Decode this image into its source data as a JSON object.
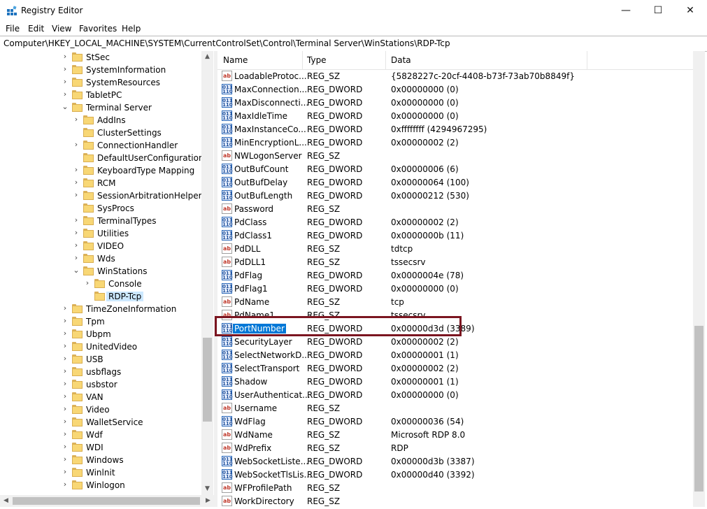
{
  "window": {
    "title": "Registry Editor",
    "minimize": "—",
    "maximize": "☐",
    "close": "✕"
  },
  "menu": [
    "File",
    "Edit",
    "View",
    "Favorites",
    "Help"
  ],
  "address": "Computer\\HKEY_LOCAL_MACHINE\\SYSTEM\\CurrentControlSet\\Control\\Terminal Server\\WinStations\\RDP-Tcp",
  "tree": [
    {
      "label": "StSec",
      "level": 0,
      "expander": "collapsed"
    },
    {
      "label": "SystemInformation",
      "level": 0,
      "expander": "collapsed"
    },
    {
      "label": "SystemResources",
      "level": 0,
      "expander": "collapsed"
    },
    {
      "label": "TabletPC",
      "level": 0,
      "expander": "collapsed"
    },
    {
      "label": "Terminal Server",
      "level": 0,
      "expander": "expanded"
    },
    {
      "label": "AddIns",
      "level": 1,
      "expander": "collapsed"
    },
    {
      "label": "ClusterSettings",
      "level": 1,
      "expander": "none"
    },
    {
      "label": "ConnectionHandler",
      "level": 1,
      "expander": "collapsed"
    },
    {
      "label": "DefaultUserConfiguration",
      "level": 1,
      "expander": "none"
    },
    {
      "label": "KeyboardType Mapping",
      "level": 1,
      "expander": "collapsed"
    },
    {
      "label": "RCM",
      "level": 1,
      "expander": "collapsed"
    },
    {
      "label": "SessionArbitrationHelper",
      "level": 1,
      "expander": "collapsed"
    },
    {
      "label": "SysProcs",
      "level": 1,
      "expander": "none"
    },
    {
      "label": "TerminalTypes",
      "level": 1,
      "expander": "collapsed"
    },
    {
      "label": "Utilities",
      "level": 1,
      "expander": "collapsed"
    },
    {
      "label": "VIDEO",
      "level": 1,
      "expander": "collapsed"
    },
    {
      "label": "Wds",
      "level": 1,
      "expander": "collapsed"
    },
    {
      "label": "WinStations",
      "level": 1,
      "expander": "expanded"
    },
    {
      "label": "Console",
      "level": 2,
      "expander": "collapsed"
    },
    {
      "label": "RDP-Tcp",
      "level": 2,
      "expander": "none",
      "selected": true
    },
    {
      "label": "TimeZoneInformation",
      "level": 0,
      "expander": "collapsed"
    },
    {
      "label": "Tpm",
      "level": 0,
      "expander": "collapsed"
    },
    {
      "label": "Ubpm",
      "level": 0,
      "expander": "collapsed"
    },
    {
      "label": "UnitedVideo",
      "level": 0,
      "expander": "collapsed"
    },
    {
      "label": "USB",
      "level": 0,
      "expander": "collapsed"
    },
    {
      "label": "usbflags",
      "level": 0,
      "expander": "collapsed"
    },
    {
      "label": "usbstor",
      "level": 0,
      "expander": "collapsed"
    },
    {
      "label": "VAN",
      "level": 0,
      "expander": "collapsed"
    },
    {
      "label": "Video",
      "level": 0,
      "expander": "collapsed"
    },
    {
      "label": "WalletService",
      "level": 0,
      "expander": "collapsed"
    },
    {
      "label": "Wdf",
      "level": 0,
      "expander": "collapsed"
    },
    {
      "label": "WDI",
      "level": 0,
      "expander": "collapsed"
    },
    {
      "label": "Windows",
      "level": 0,
      "expander": "collapsed"
    },
    {
      "label": "Winlnit",
      "level": 0,
      "expander": "collapsed"
    },
    {
      "label": "Winlogon",
      "level": 0,
      "expander": "collapsed"
    }
  ],
  "columns": {
    "name": "Name",
    "type": "Type",
    "data": "Data"
  },
  "values": [
    {
      "name": "LoadableProtoc...",
      "type": "REG_SZ",
      "data": "{5828227c-20cf-4408-b73f-73ab70b8849f}",
      "icon": "string"
    },
    {
      "name": "MaxConnection...",
      "type": "REG_DWORD",
      "data": "0x00000000 (0)",
      "icon": "binary"
    },
    {
      "name": "MaxDisconnecti...",
      "type": "REG_DWORD",
      "data": "0x00000000 (0)",
      "icon": "binary"
    },
    {
      "name": "MaxIdleTime",
      "type": "REG_DWORD",
      "data": "0x00000000 (0)",
      "icon": "binary"
    },
    {
      "name": "MaxInstanceCo...",
      "type": "REG_DWORD",
      "data": "0xffffffff (4294967295)",
      "icon": "binary"
    },
    {
      "name": "MinEncryptionL...",
      "type": "REG_DWORD",
      "data": "0x00000002 (2)",
      "icon": "binary"
    },
    {
      "name": "NWLogonServer",
      "type": "REG_SZ",
      "data": "",
      "icon": "string"
    },
    {
      "name": "OutBufCount",
      "type": "REG_DWORD",
      "data": "0x00000006 (6)",
      "icon": "binary"
    },
    {
      "name": "OutBufDelay",
      "type": "REG_DWORD",
      "data": "0x00000064 (100)",
      "icon": "binary"
    },
    {
      "name": "OutBufLength",
      "type": "REG_DWORD",
      "data": "0x00000212 (530)",
      "icon": "binary"
    },
    {
      "name": "Password",
      "type": "REG_SZ",
      "data": "",
      "icon": "string"
    },
    {
      "name": "PdClass",
      "type": "REG_DWORD",
      "data": "0x00000002 (2)",
      "icon": "binary"
    },
    {
      "name": "PdClass1",
      "type": "REG_DWORD",
      "data": "0x0000000b (11)",
      "icon": "binary"
    },
    {
      "name": "PdDLL",
      "type": "REG_SZ",
      "data": "tdtcp",
      "icon": "string"
    },
    {
      "name": "PdDLL1",
      "type": "REG_SZ",
      "data": "tssecsrv",
      "icon": "string"
    },
    {
      "name": "PdFlag",
      "type": "REG_DWORD",
      "data": "0x0000004e (78)",
      "icon": "binary"
    },
    {
      "name": "PdFlag1",
      "type": "REG_DWORD",
      "data": "0x00000000 (0)",
      "icon": "binary"
    },
    {
      "name": "PdName",
      "type": "REG_SZ",
      "data": "tcp",
      "icon": "string"
    },
    {
      "name": "PdName1",
      "type": "REG_SZ",
      "data": "tssecsrv",
      "icon": "string"
    },
    {
      "name": "PortNumber",
      "type": "REG_DWORD",
      "data": "0x00000d3d (3389)",
      "icon": "binary",
      "selected": true
    },
    {
      "name": "SecurityLayer",
      "type": "REG_DWORD",
      "data": "0x00000002 (2)",
      "icon": "binary"
    },
    {
      "name": "SelectNetworkD...",
      "type": "REG_DWORD",
      "data": "0x00000001 (1)",
      "icon": "binary"
    },
    {
      "name": "SelectTransport",
      "type": "REG_DWORD",
      "data": "0x00000002 (2)",
      "icon": "binary"
    },
    {
      "name": "Shadow",
      "type": "REG_DWORD",
      "data": "0x00000001 (1)",
      "icon": "binary"
    },
    {
      "name": "UserAuthenticat...",
      "type": "REG_DWORD",
      "data": "0x00000000 (0)",
      "icon": "binary"
    },
    {
      "name": "Username",
      "type": "REG_SZ",
      "data": "",
      "icon": "string"
    },
    {
      "name": "WdFlag",
      "type": "REG_DWORD",
      "data": "0x00000036 (54)",
      "icon": "binary"
    },
    {
      "name": "WdName",
      "type": "REG_SZ",
      "data": "Microsoft RDP 8.0",
      "icon": "string"
    },
    {
      "name": "WdPrefix",
      "type": "REG_SZ",
      "data": "RDP",
      "icon": "string"
    },
    {
      "name": "WebSocketListe...",
      "type": "REG_DWORD",
      "data": "0x00000d3b (3387)",
      "icon": "binary"
    },
    {
      "name": "WebSocketTlsLis...",
      "type": "REG_DWORD",
      "data": "0x00000d40 (3392)",
      "icon": "binary"
    },
    {
      "name": "WFProfilePath",
      "type": "REG_SZ",
      "data": "",
      "icon": "string"
    },
    {
      "name": "WorkDirectory",
      "type": "REG_SZ",
      "data": "",
      "icon": "string"
    }
  ],
  "icons": {
    "string": "ab",
    "binary": "011\n110"
  },
  "colors": {
    "highlight_box": "#7b1520",
    "selection": "#0078d7",
    "tree_selection": "#cce8ff"
  }
}
